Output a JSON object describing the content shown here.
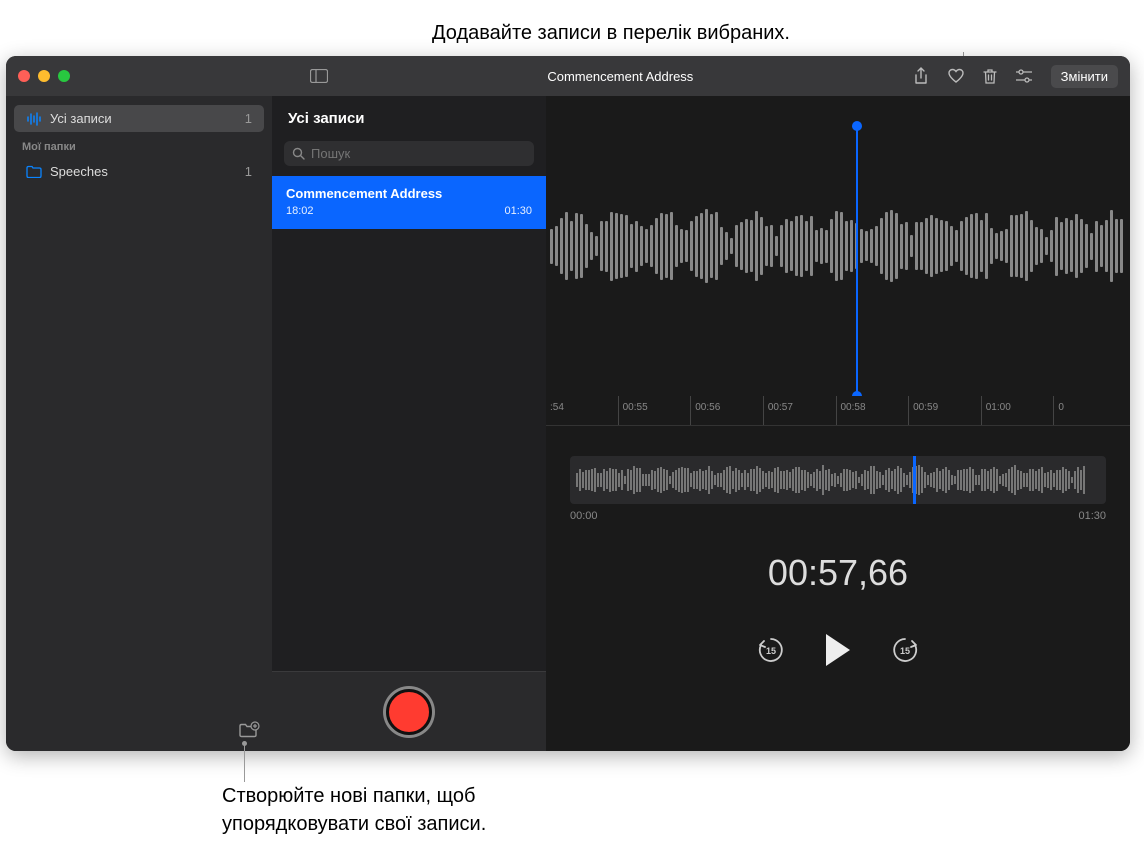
{
  "callouts": {
    "top": "Додавайте записи в перелік вибраних.",
    "bottom_line1": "Створюйте нові папки, щоб",
    "bottom_line2": "упорядковувати свої записи."
  },
  "titlebar": {
    "title": "Commencement Address",
    "edit_label": "Змінити"
  },
  "sidebar": {
    "all_recordings_label": "Усі записи",
    "all_recordings_count": "1",
    "section_header": "Мої папки",
    "folders": [
      {
        "name": "Speeches",
        "count": "1"
      }
    ]
  },
  "list": {
    "header": "Усі записи",
    "search_placeholder": "Пошук",
    "items": [
      {
        "title": "Commencement Address",
        "time": "18:02",
        "duration": "01:30"
      }
    ]
  },
  "detail": {
    "ruler_ticks": [
      ":54",
      "00:55",
      "00:56",
      "00:57",
      "00:58",
      "00:59",
      "01:00",
      "0"
    ],
    "overview_start": "00:00",
    "overview_end": "01:30",
    "current_time": "00:57,66",
    "skip_back_seconds": "15",
    "skip_forward_seconds": "15"
  }
}
